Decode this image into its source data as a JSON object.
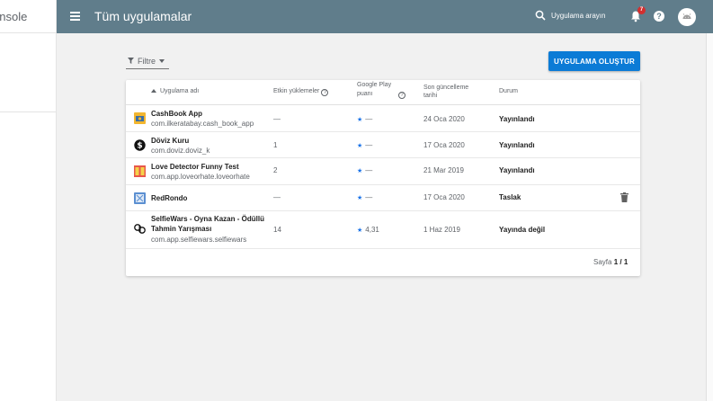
{
  "sidebar": {
    "brand": "onsole"
  },
  "header": {
    "title": "Tüm uygulamalar",
    "search_placeholder": "Uygulama arayın",
    "notification_count": "7",
    "help": "?"
  },
  "filter": {
    "label": "Filtre"
  },
  "create_button": {
    "label": "UYGULAMA OLUŞTUR"
  },
  "table": {
    "headers": {
      "name": "Uygulama adı",
      "installs": "Etkin yüklemeler",
      "rating": "Google Play puanı",
      "updated": "Son güncelleme tarihi",
      "status": "Durum"
    },
    "rows": [
      {
        "title": "CashBook App",
        "package": "com.ilkeratabay.cash_book_app",
        "installs": "—",
        "rating": "—",
        "updated": "24 Oca 2020",
        "status": "Yayınlandı"
      },
      {
        "title": "Döviz Kuru",
        "package": "com.doviz.doviz_k",
        "installs": "1",
        "rating": "—",
        "updated": "17 Oca 2020",
        "status": "Yayınlandı"
      },
      {
        "title": "Love Detector Funny Test",
        "package": "com.app.loveorhate.loveorhate",
        "installs": "2",
        "rating": "—",
        "updated": "21 Mar 2019",
        "status": "Yayınlandı"
      },
      {
        "title": "RedRondo",
        "package": "",
        "installs": "—",
        "rating": "—",
        "updated": "17 Oca 2020",
        "status": "Taslak"
      },
      {
        "title": "SelfieWars - Oyna Kazan - Ödüllü Tahmin Yarışması",
        "package": "com.app.selfiewars.selfiewars",
        "installs": "14",
        "rating": "4,31",
        "updated": "1 Haz 2019",
        "status": "Yayında değil"
      }
    ]
  },
  "pagination": {
    "prefix": "Sayfa",
    "current": "1 / 1"
  },
  "colors": {
    "topbar": "#607d8b",
    "primary_button": "#0b7bd6",
    "star": "#1a73e8"
  },
  "icons": {
    "menu": "menu-icon",
    "search": "search-icon",
    "bell": "bell-icon",
    "help": "help-icon",
    "avatar": "android-avatar",
    "filter": "funnel-icon",
    "trash": "trash-icon"
  }
}
